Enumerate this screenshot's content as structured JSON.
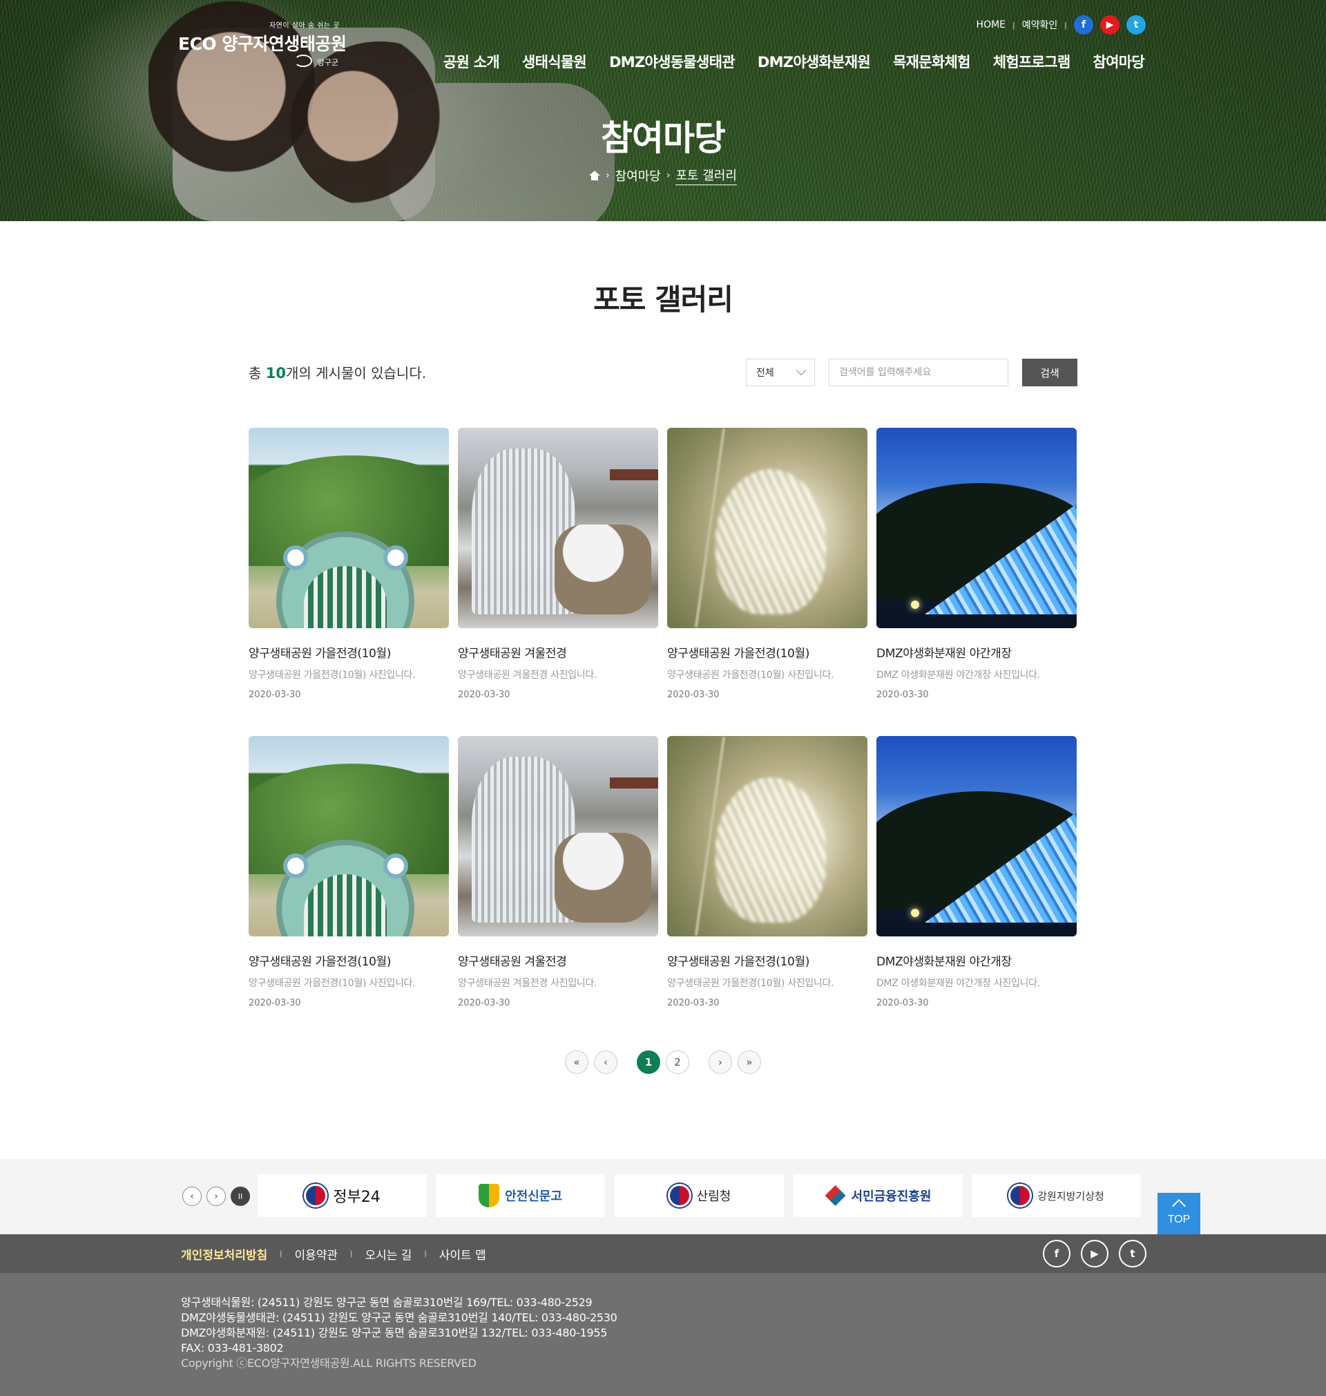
{
  "header": {
    "logo_tagline": "자연이 살아 숨 쉬는 곳",
    "logo_main": "ECO 양구자연생태공원",
    "logo_sub": "양구군",
    "top_links": [
      "HOME",
      "예약확인"
    ],
    "sns": [
      "f",
      "▶",
      "t"
    ],
    "nav": [
      "공원 소개",
      "생태식물원",
      "DMZ야생동물생태관",
      "DMZ야생화분재원",
      "목재문화체험",
      "체험프로그램",
      "참여마당"
    ]
  },
  "hero": {
    "title": "참여마당",
    "breadcrumb": [
      "참여마당",
      "포토 갤러리"
    ]
  },
  "page": {
    "title": "포토 갤러리",
    "count_prefix": "총 ",
    "count": "10",
    "count_suffix": "개의 게시물이 있습니다."
  },
  "search": {
    "select_value": "전체",
    "placeholder": "검색어를 입력해주세요",
    "button": "검색"
  },
  "gallery": [
    {
      "title": "양구생태공원 가을전경(10월)",
      "desc": "양구생태공원 가을전경(10월) 사진입니다.",
      "date": "2020-03-30",
      "thumb": "slide"
    },
    {
      "title": "양구생태공원 겨울전경",
      "desc": "양구생태공원 겨울전경 사진입니다.",
      "date": "2020-03-30",
      "thumb": "winter"
    },
    {
      "title": "양구생태공원 가을전경(10월)",
      "desc": "양구생태공원 가을전경(10월) 사진입니다.",
      "date": "2020-03-30",
      "thumb": "reed"
    },
    {
      "title": "DMZ야생화분재원 야간개장",
      "desc": "DMZ 야생화분재원 야간개장 사진입니다.",
      "date": "2020-03-30",
      "thumb": "night"
    },
    {
      "title": "양구생태공원 가을전경(10월)",
      "desc": "양구생태공원 가을전경(10월) 사진입니다.",
      "date": "2020-03-30",
      "thumb": "slide"
    },
    {
      "title": "양구생태공원 겨울전경",
      "desc": "양구생태공원 겨울전경 사진입니다.",
      "date": "2020-03-30",
      "thumb": "winter"
    },
    {
      "title": "양구생태공원 가을전경(10월)",
      "desc": "양구생태공원 가을전경(10월) 사진입니다.",
      "date": "2020-03-30",
      "thumb": "reed"
    },
    {
      "title": "DMZ야생화분재원 야간개장",
      "desc": "DMZ 야생화분재원 야간개장 사진입니다.",
      "date": "2020-03-30",
      "thumb": "night"
    }
  ],
  "pagination": {
    "first": "«",
    "prev": "‹",
    "pages": [
      "1",
      "2"
    ],
    "current": "1",
    "next": "›",
    "last": "»"
  },
  "banners": {
    "controls": [
      "‹",
      "›",
      "II"
    ],
    "items": [
      "정부24",
      "안전신문고",
      "산림청",
      "서민금융진흥원",
      "강원지방기상청"
    ]
  },
  "top_button": "TOP",
  "footer": {
    "links": [
      "개인정보처리방침",
      "이용약관",
      "오시는 길",
      "사이트 맵"
    ],
    "sns": [
      "f",
      "▶",
      "t"
    ],
    "addresses": [
      "양구생태식물원: (24511) 강원도 양구군 동면 숨골로310번길 169/TEL: 033-480-2529",
      "DMZ야생동물생태관: (24511) 강원도 양구군 동면 숨골로310번길 140/TEL: 033-480-2530",
      "DMZ야생화분재원: (24511) 강원도 양구군 동면 숨골로310번길 132/TEL: 033-480-1955",
      "FAX: 033-481-3802"
    ],
    "copyright": "Copyright ⓒECO양구자연생태공원.ALL RIGHTS RESERVED"
  },
  "colors": {
    "accent": "#0d7f55",
    "top_button": "#2f8fe0",
    "footer_bar": "#595959",
    "footer": "#707070"
  }
}
